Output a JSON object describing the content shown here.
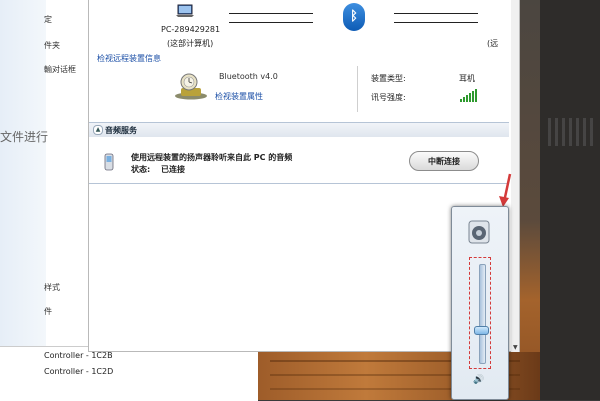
{
  "left_panel": {
    "items": [
      "定",
      "件夹",
      "輸对话框",
      "样式",
      "件"
    ]
  },
  "background": {
    "faded_left": "文件进行"
  },
  "device_list": {
    "rows": [
      "Controller - 1C2B",
      "Controller - 1C2D"
    ]
  },
  "header": {
    "pc_name": "PC-289429281",
    "pc_sub": "(这部计算机)",
    "right_truncated": "(远",
    "bt_symbol": "ᛒ"
  },
  "remote": {
    "link": "检视远程装置信息"
  },
  "device": {
    "name": "Bluetooth v4.0",
    "link": "检视装置属性",
    "type_label": "装置类型:",
    "type_value": "耳机",
    "signal_label": "讯号强度:",
    "signal_level": 0.85
  },
  "audio_service": {
    "title": "音频服务",
    "description": "使用远程装置的扬声器聆听来自此 PC 的音频",
    "status_label": "状态:",
    "status_value": "已连接",
    "disconnect_label": "中断连接"
  },
  "volume": {
    "level": 0.32,
    "speaker_glyph": "🔊"
  },
  "colors": {
    "link": "#1a4ea6",
    "accent_red": "#d43a3a",
    "bluetooth": "#0d5bb5",
    "signal": "#2e9a2e"
  },
  "icons": [
    "computer-icon",
    "bluetooth-icon",
    "bluetooth-device-icon",
    "signal-icon",
    "phone-icon",
    "speaker-device-icon",
    "speaker-icon",
    "chevron-up-icon"
  ]
}
